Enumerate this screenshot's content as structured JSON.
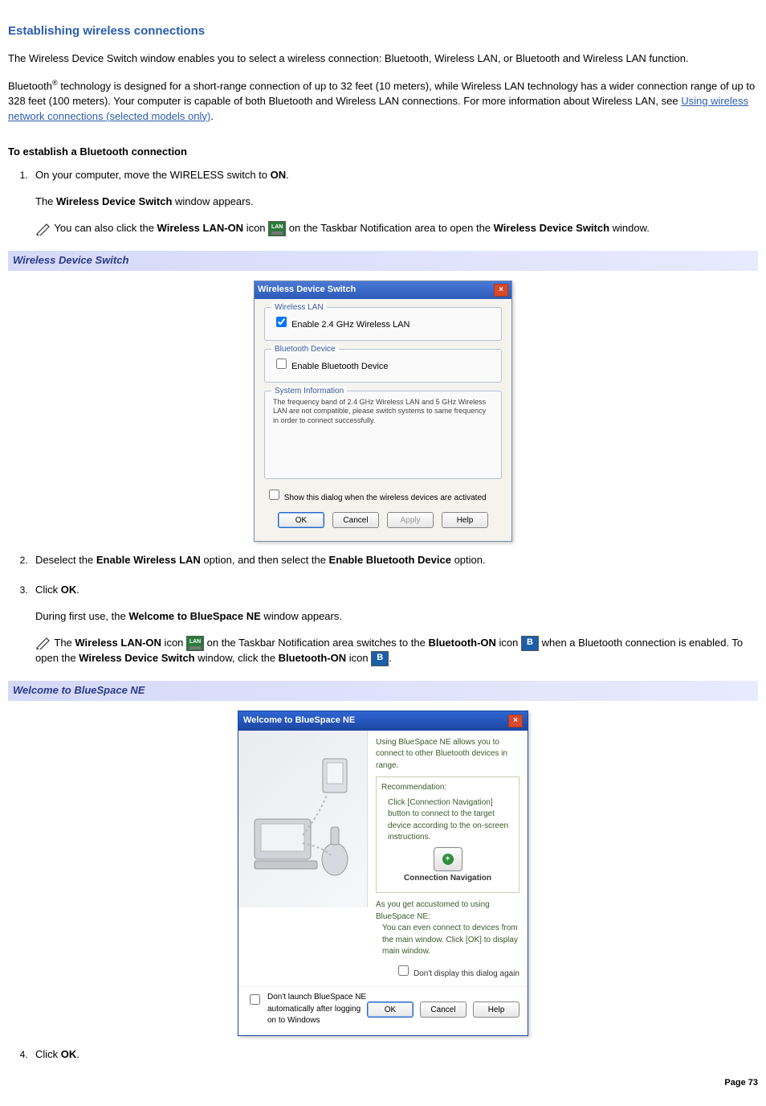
{
  "title": "Establishing wireless connections",
  "intro1": "The Wireless Device Switch window enables you to select a wireless connection: Bluetooth, Wireless LAN, or Bluetooth and Wireless LAN function.",
  "intro2_a": "Bluetooth",
  "intro2_sup": "®",
  "intro2_b": " technology is designed for a short-range connection of up to 32 feet (10 meters), while Wireless LAN technology has a wider connection range of up to 328 feet (100 meters). Your computer is capable of both Bluetooth and Wireless LAN connections. For more information about Wireless LAN, see ",
  "intro2_link": "Using wireless network connections (selected models only)",
  "intro2_c": ".",
  "sub_heading": "To establish a Bluetooth connection",
  "step1_a": "On your computer, move the WIRELESS switch to ",
  "step1_b": "ON",
  "step1_c": ".",
  "step1_result_a": "The ",
  "step1_result_b": "Wireless Device Switch",
  "step1_result_c": " window appears.",
  "note1_a": " You can also click the ",
  "note1_b": "Wireless LAN-ON",
  "note1_c": " icon ",
  "note1_d": " on the Taskbar Notification area to open the ",
  "note1_e": "Wireless Device Switch",
  "note1_f": " window.",
  "caption1": "Wireless Device Switch",
  "wds": {
    "title": "Wireless Device Switch",
    "group1": "Wireless LAN",
    "opt1": "Enable 2.4 GHz Wireless LAN",
    "group2": "Bluetooth Device",
    "opt2": "Enable Bluetooth Device",
    "group3": "System Information",
    "sysinfo": "The frequency band of 2.4 GHz Wireless LAN and 5 GHz Wireless LAN are not compatible, please switch systems to same frequency in order to connect successfully.",
    "show_check": "Show this dialog when the wireless devices are activated",
    "btn_ok": "OK",
    "btn_cancel": "Cancel",
    "btn_apply": "Apply",
    "btn_help": "Help"
  },
  "step2_a": "Deselect the ",
  "step2_b": "Enable Wireless LAN",
  "step2_c": " option, and then select the ",
  "step2_d": "Enable Bluetooth Device",
  "step2_e": " option.",
  "step3_a": "Click ",
  "step3_b": "OK",
  "step3_c": ".",
  "step3_result_a": "During first use, the ",
  "step3_result_b": "Welcome to BlueSpace NE",
  "step3_result_c": " window appears.",
  "note2_a": " The ",
  "note2_b": "Wireless LAN-ON",
  "note2_c": " icon ",
  "note2_d": " on the Taskbar Notification area switches to the ",
  "note2_e": "Bluetooth-ON",
  "note2_f": " icon ",
  "note2_g": " when a Bluetooth connection is enabled. To open the ",
  "note2_h": "Wireless Device Switch",
  "note2_i": " window, click the ",
  "note2_j": "Bluetooth-ON",
  "note2_k": " icon ",
  "note2_l": ".",
  "caption2": "Welcome to BlueSpace NE",
  "bsn": {
    "title": "Welcome to BlueSpace NE",
    "desc": "Using BlueSpace NE allows you to connect to other Bluetooth devices in range.",
    "rec_label": "Recommendation:",
    "rec_text": "Click [Connection Navigation] button to connect to the target device according to the on-screen instructions.",
    "conn_label": "Connection Navigation",
    "accustom1": "As you get accustomed to using BlueSpace NE:",
    "accustom2": "You can even connect to devices from the main window. Click [OK] to display main window.",
    "dont_display": "Don't display this dialog again",
    "dont_launch": "Don't launch BlueSpace NE automatically after logging on to Windows",
    "btn_ok": "OK",
    "btn_cancel": "Cancel",
    "btn_help": "Help"
  },
  "step4_a": "Click ",
  "step4_b": "OK",
  "step4_c": ".",
  "page_num": "Page 73"
}
